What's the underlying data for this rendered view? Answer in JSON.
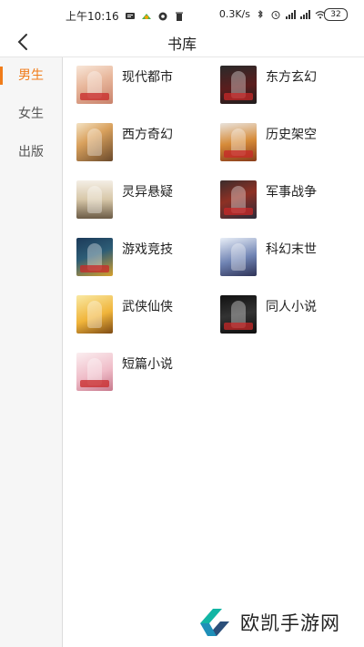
{
  "status_bar": {
    "time": "上午10:16",
    "speed": "0.3K/s",
    "battery": "32",
    "left_icons": [
      "message-icon",
      "app-icon",
      "record-icon",
      "delete-icon"
    ],
    "right_icons": [
      "bluetooth-icon",
      "alarm-icon",
      "signal-icon",
      "signal-icon",
      "wifi-icon"
    ]
  },
  "header": {
    "back_icon": "chevron-left-icon",
    "title": "书库"
  },
  "sidebar": {
    "items": [
      {
        "label": "男生",
        "active": true
      },
      {
        "label": "女生",
        "active": false
      },
      {
        "label": "出版",
        "active": false
      }
    ]
  },
  "categories": [
    {
      "label": "现代都市"
    },
    {
      "label": "东方玄幻"
    },
    {
      "label": "西方奇幻"
    },
    {
      "label": "历史架空"
    },
    {
      "label": "灵异悬疑"
    },
    {
      "label": "军事战争"
    },
    {
      "label": "游戏竞技"
    },
    {
      "label": "科幻末世"
    },
    {
      "label": "武侠仙侠"
    },
    {
      "label": "同人小说"
    },
    {
      "label": "短篇小说"
    }
  ],
  "watermark": {
    "text": "欧凯手游网"
  },
  "colors": {
    "accent": "#f07c1a",
    "sidebar_bg": "#f6f6f6"
  }
}
